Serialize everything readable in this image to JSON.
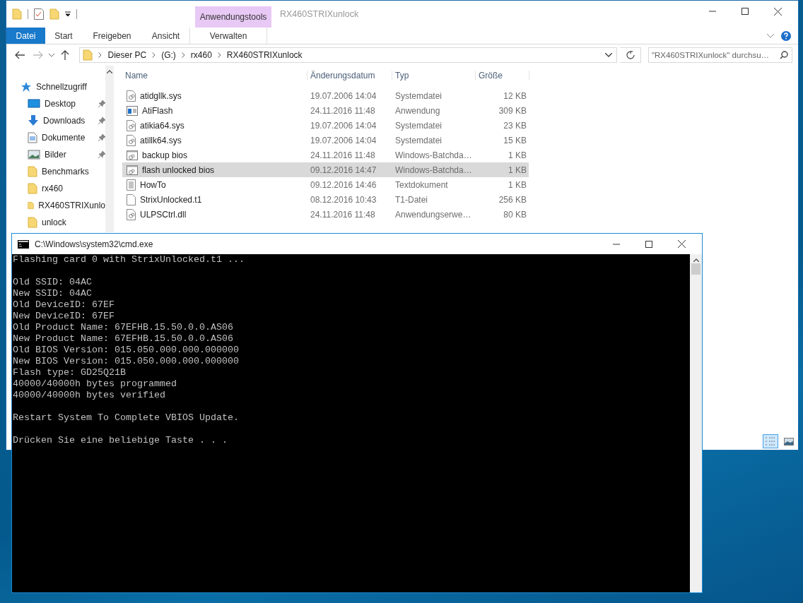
{
  "explorer": {
    "contextual_group": "Anwendungstools",
    "title": "RX460STRIXunlock",
    "ribbon_tabs": [
      {
        "label": "Datei",
        "kind": "file"
      },
      {
        "label": "Start",
        "kind": "tab"
      },
      {
        "label": "Freigeben",
        "kind": "tab"
      },
      {
        "label": "Ansicht",
        "kind": "tab"
      },
      {
        "label": "Verwalten",
        "kind": "contextual"
      }
    ],
    "breadcrumbs": [
      "Dieser PC",
      "(G:)",
      "rx460",
      "RX460STRIXunlock"
    ],
    "search": {
      "placeholder": "\"RX460STRIXunlock\" durchsu…"
    },
    "nav": [
      {
        "label": "Schnellzugriff",
        "kind": "quick",
        "children": [
          {
            "label": "Desktop",
            "kind": "desktop",
            "pinned": true
          },
          {
            "label": "Downloads",
            "kind": "downloads",
            "pinned": true
          },
          {
            "label": "Dokumente",
            "kind": "documents",
            "pinned": true
          },
          {
            "label": "Bilder",
            "kind": "pictures",
            "pinned": true
          },
          {
            "label": "Benchmarks",
            "kind": "folder",
            "pinned": false
          },
          {
            "label": "rx460",
            "kind": "folder",
            "pinned": false
          },
          {
            "label": "RX460STRIXunlo",
            "kind": "folder",
            "pinned": false
          },
          {
            "label": "unlock",
            "kind": "folder",
            "pinned": false
          }
        ]
      }
    ],
    "columns": [
      "Name",
      "Änderungsdatum",
      "Typ",
      "Größe"
    ],
    "rows": [
      {
        "name": "atidgllk.sys",
        "date": "19.07.2006 14:04",
        "type": "Systemdatei",
        "size": "12 KB",
        "kind": "system",
        "selected": false
      },
      {
        "name": "AtiFlash",
        "date": "24.11.2016 11:48",
        "type": "Anwendung",
        "size": "309 KB",
        "kind": "app",
        "selected": false
      },
      {
        "name": "atikia64.sys",
        "date": "19.07.2006 14:04",
        "type": "Systemdatei",
        "size": "23 KB",
        "kind": "system",
        "selected": false
      },
      {
        "name": "atillk64.sys",
        "date": "19.07.2006 14:04",
        "type": "Systemdatei",
        "size": "15 KB",
        "kind": "system",
        "selected": false
      },
      {
        "name": "backup bios",
        "date": "24.11.2016 11:48",
        "type": "Windows-Batchda…",
        "size": "1 KB",
        "kind": "batch",
        "selected": false
      },
      {
        "name": "flash unlocked bios",
        "date": "09.12.2016 14:47",
        "type": "Windows-Batchda…",
        "size": "1 KB",
        "kind": "batch",
        "selected": true
      },
      {
        "name": "HowTo",
        "date": "09.12.2016 14:46",
        "type": "Textdokument",
        "size": "1 KB",
        "kind": "text",
        "selected": false
      },
      {
        "name": "StrixUnlocked.t1",
        "date": "08.12.2016 10:43",
        "type": "T1-Datei",
        "size": "256 KB",
        "kind": "file",
        "selected": false
      },
      {
        "name": "ULPSCtrl.dll",
        "date": "24.11.2016 11:48",
        "type": "Anwendungserwe…",
        "size": "80 KB",
        "kind": "system",
        "selected": false
      }
    ],
    "view_modes": [
      {
        "kind": "details",
        "selected": true
      },
      {
        "kind": "tiles",
        "selected": false
      }
    ]
  },
  "console": {
    "title": "C:\\Windows\\system32\\cmd.exe",
    "blocks": [
      [
        "Flashing card 0 with StrixUnlocked.t1 ..."
      ],
      [
        "Old SSID: 04AC",
        "New SSID: 04AC",
        "Old DeviceID: 67EF",
        "New DeviceID: 67EF",
        "Old Product Name: 67EFHB.15.50.0.0.AS06",
        "New Product Name: 67EFHB.15.50.0.0.AS06",
        "Old BIOS Version: 015.050.000.000.000000",
        "New BIOS Version: 015.050.000.000.000000",
        "Flash type: GD25Q21B",
        "40000/40000h bytes programmed",
        "40000/40000h bytes verified"
      ],
      [
        "Restart System To Complete VBIOS Update."
      ],
      [
        "Drücken Sie eine beliebige Taste . . ."
      ]
    ]
  }
}
